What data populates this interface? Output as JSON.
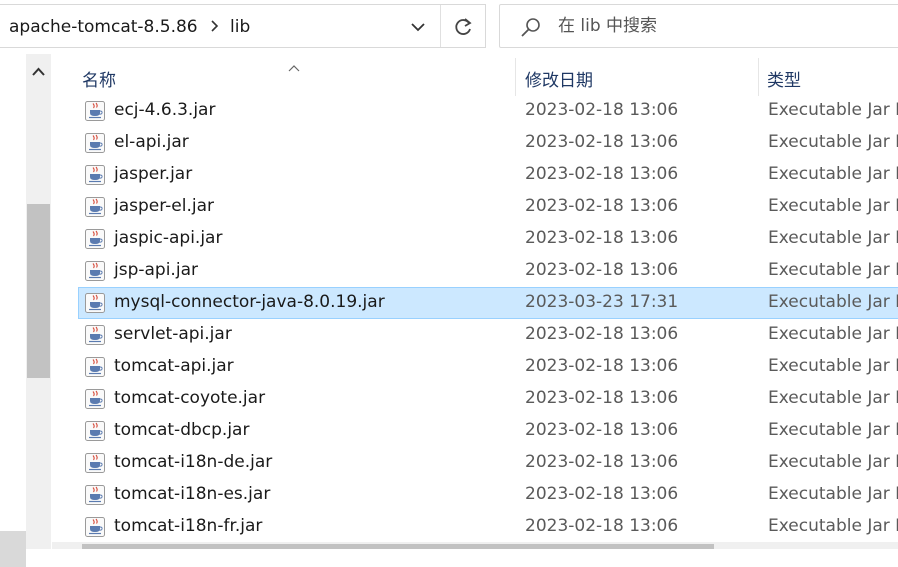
{
  "address_bar": {
    "breadcrumbs": [
      "apache-tomcat-8.5.86",
      "lib"
    ],
    "separator_icon": "chevron-right-icon",
    "dropdown_icon": "chevron-down-icon",
    "refresh_icon": "refresh-icon"
  },
  "search": {
    "placeholder": "在 lib 中搜索",
    "value": "",
    "icon": "search-icon"
  },
  "columns": {
    "name": "名称",
    "date": "修改日期",
    "type": "类型"
  },
  "sort": {
    "column": "name",
    "direction": "ascending"
  },
  "files": [
    {
      "name": "ecj-4.6.3.jar",
      "date": "2023-02-18 13:06",
      "type": "Executable Jar I"
    },
    {
      "name": "el-api.jar",
      "date": "2023-02-18 13:06",
      "type": "Executable Jar I"
    },
    {
      "name": "jasper.jar",
      "date": "2023-02-18 13:06",
      "type": "Executable Jar I"
    },
    {
      "name": "jasper-el.jar",
      "date": "2023-02-18 13:06",
      "type": "Executable Jar I"
    },
    {
      "name": "jaspic-api.jar",
      "date": "2023-02-18 13:06",
      "type": "Executable Jar I"
    },
    {
      "name": "jsp-api.jar",
      "date": "2023-02-18 13:06",
      "type": "Executable Jar I"
    },
    {
      "name": "mysql-connector-java-8.0.19.jar",
      "date": "2023-03-23 17:31",
      "type": "Executable Jar I"
    },
    {
      "name": "servlet-api.jar",
      "date": "2023-02-18 13:06",
      "type": "Executable Jar I"
    },
    {
      "name": "tomcat-api.jar",
      "date": "2023-02-18 13:06",
      "type": "Executable Jar I"
    },
    {
      "name": "tomcat-coyote.jar",
      "date": "2023-02-18 13:06",
      "type": "Executable Jar I"
    },
    {
      "name": "tomcat-dbcp.jar",
      "date": "2023-02-18 13:06",
      "type": "Executable Jar I"
    },
    {
      "name": "tomcat-i18n-de.jar",
      "date": "2023-02-18 13:06",
      "type": "Executable Jar I"
    },
    {
      "name": "tomcat-i18n-es.jar",
      "date": "2023-02-18 13:06",
      "type": "Executable Jar I"
    },
    {
      "name": "tomcat-i18n-fr.jar",
      "date": "2023-02-18 13:06",
      "type": "Executable Jar I"
    }
  ],
  "selected_file": "mysql-connector-java-8.0.19.jar",
  "file_icon": "java-jar-file-icon",
  "colors": {
    "selection_bg": "#cce8ff",
    "selection_border": "#99d1ff",
    "header_text": "#1f3864",
    "secondary_text": "#5a5a5a"
  }
}
